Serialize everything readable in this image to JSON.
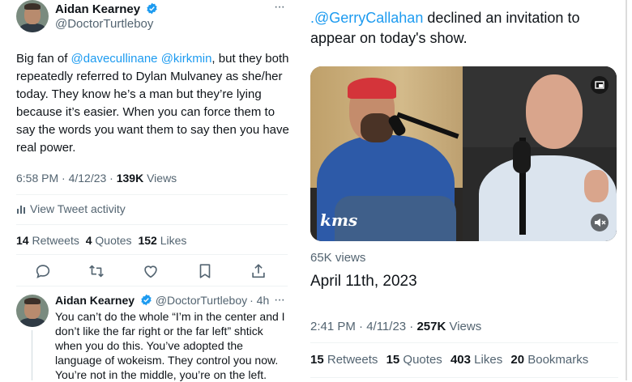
{
  "left_tweet": {
    "author_name": "Aidan Kearney",
    "author_handle": "@DoctorTurtleboy",
    "more_label": "···",
    "text_parts": [
      "Big fan of ",
      "@davecullinane",
      " ",
      "@kirkmin",
      ", but they both repeatedly referred to Dylan Mulvaney as she/her today. They know he’s a man but they’re lying because it’s easier. When you can force them to say the words you want them to say then you have real power."
    ],
    "timestamp": "6:58 PM · 4/12/23 · ",
    "views_count": "139K",
    "views_label": " Views",
    "activity_label": "View Tweet activity",
    "retweets_count": "14",
    "retweets_label": "Retweets",
    "quotes_count": "4",
    "quotes_label": "Quotes",
    "likes_count": "152",
    "likes_label": "Likes",
    "action_icons": [
      "reply-icon",
      "retweet-icon",
      "like-icon",
      "bookmark-icon",
      "share-icon"
    ]
  },
  "reply_tweet": {
    "author_name": "Aidan Kearney",
    "author_handle": "@DoctorTurtleboy",
    "age": "· 4h",
    "more_label": "···",
    "text": "You can’t do the whole “I’m in the center and I don’t like the far right or the far left” shtick when you do this. You’ve adopted the language of wokeism. They control you now. You’re not in the middle, you’re on the left."
  },
  "right_tweet": {
    "mention": ".@GerryCallahan",
    "text": " declined an invitation to appear on today's show.",
    "video_logo": "kms",
    "views": "65K views",
    "date": "April 11th, 2023",
    "timestamp": "2:41 PM · 4/11/23 · ",
    "views_count": "257K",
    "views_label": " Views",
    "retweets_count": "15",
    "retweets_label": "Retweets",
    "quotes_count": "15",
    "quotes_label": "Quotes",
    "likes_count": "403",
    "likes_label": "Likes",
    "bookmarks_count": "20",
    "bookmarks_label": "Bookmarks"
  },
  "colors": {
    "link": "#1d9bf0",
    "muted": "#536471",
    "text": "#0f1419",
    "divider": "#eff3f4"
  }
}
